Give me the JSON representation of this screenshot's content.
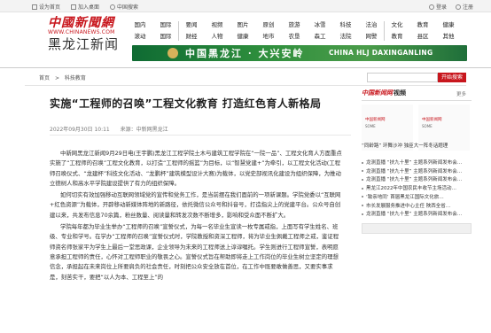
{
  "topbar": {
    "left": [
      "设为首页",
      "加入桌面",
      "中国搜索"
    ],
    "right": [
      "登录",
      "注册"
    ]
  },
  "logo": {
    "cn": "中國新聞網",
    "url": "WWW.CHINANEWS.COM",
    "region": "黑龙江新闻"
  },
  "nav": {
    "columns": [
      [
        "国内",
        "滚动"
      ],
      [
        "国际",
        "国际"
      ],
      [
        "要闻",
        "财经"
      ],
      [
        "视频",
        "人物"
      ],
      [
        "图片",
        "健康"
      ],
      [
        "原创",
        "地市"
      ],
      [
        "旅游",
        "农垦"
      ],
      [
        "冰雪",
        "森工"
      ],
      [
        "科技",
        "法院"
      ],
      [
        "法治",
        "网警"
      ],
      [
        "文化",
        "教育"
      ],
      [
        "教育",
        "县区"
      ],
      [
        "健康",
        "其他"
      ]
    ]
  },
  "banner": {
    "title": "中国黑龙江 · 大兴安岭",
    "sub": "CHINA HLJ DAXINGANLING"
  },
  "search": {
    "button": "开始搜索"
  },
  "breadcrumb": [
    "首页",
    "科技教育"
  ],
  "article": {
    "title": "实施“工程师的召唤”工程文化教育 打造红色育人新格局",
    "date": "2022年09月30日 10:11",
    "source": "来源：中新网黑龙江",
    "paragraphs": [
      "中新网黑龙江新闻9月29日电(王宇鹏)黑龙江工程学院土木与建筑工程学院在“一院一品”、工程文化育人方面重点实施了“工程师的召唤”工程文化教育，以打造“工程师的摇篮”为目标，以“智慧党建+”为牵引，以工程文化活动(工程师召唤仪式、“龙建杯”科技文化活动、“龙鹏杯”建筑模型设计大赛)为载体，以党史部视讯化建设为组织保障，为推动立德树人和高水平学院建设提供了有力的组织保障。",
      "如何切实有效加强移动互联网领域党的宣传和党务工作，是当前摆在我们面前的一项新课题。学院党委以“互联网+红色资源”为载体，开辟移动新媒体阵地的新路径，依托微信公众号和抖音号，打造指尖上的党建平台。公众号自创建以来，共发布信息70余篇，粉丝数量、阅读量和转发次数不断增多，影响和受众面不断扩大。",
      "学院每年都为毕业生举办“工程师的召唤”宣誓仪式，为每一名毕业生宣读一枚专属戒指，上面写有学生姓名、班级、专业和学号。在学办“工程师的召唤”宣誓仪式时，学院教授和资深工程师，将为毕业生佩戴工程师之戒，鉴证程师资名师张家平为学生上最后一堂思政课，企业领导为未来的工程师送上谆谆嘱托。学生则进行工程师宣誓，表明愿意承担工程师的责任，心怀对工程师职业的敬畏之心。宣誓仪式旨在帮助即将走上工作岗位的毕业生树立坚定的理想信念，承担起在未来岗位上所要肩负的社会责任，时刻把公众安全放在首位，在工作中既要敢做善思，又要实事求是，刻苦实干，要把“以人为本、工程至上”的"
    ]
  },
  "sidebar": {
    "brand": "中国新闻网",
    "label": "视频",
    "more": "更多",
    "thumbs": [
      {
        "brand": "中国新闻网",
        "text": "SOME"
      },
      {
        "brand": "中国新闻网",
        "text": "SOME"
      }
    ],
    "caption": "“同龄路” 环舞沙冲  独臣大一阵冬话题理",
    "items": [
      "龙测直播 “扶九十里” 主题系列新闻发布会…",
      "龙测直播 “扶九十里” 主题系列新闻发布会…",
      "龙测直播 “扶九十里” 主题系列新闻发布会…",
      "黑龙江2022年中国农民丰收节主场活动…",
      "‘致亲地同’ 首届黑龙江国际文化旅…",
      "市长发展服务推进中心主任 陕西全省…",
      "龙测直播 “扶九十里” 主题系列新闻发布会…"
    ]
  }
}
